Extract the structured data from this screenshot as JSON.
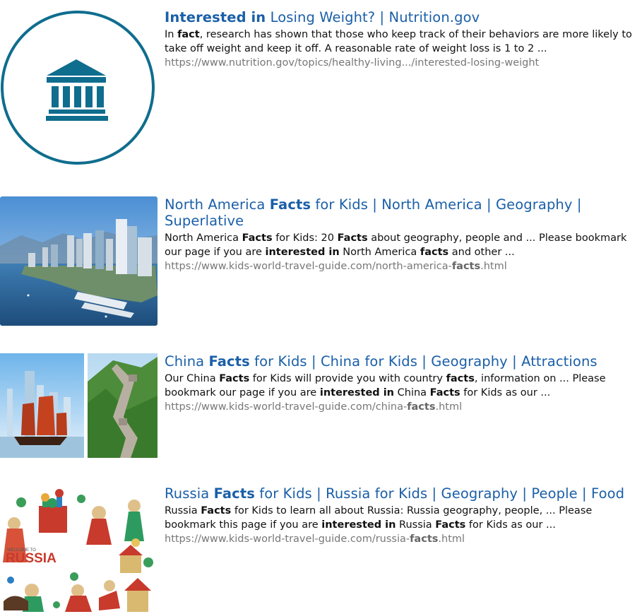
{
  "results": [
    {
      "title": [
        {
          "t": "Interested in",
          "b": true
        },
        {
          "t": " Losing Weight? | Nutrition.gov",
          "b": false
        }
      ],
      "snippet": [
        {
          "t": "In ",
          "b": false
        },
        {
          "t": "fact",
          "b": true
        },
        {
          "t": ", research has shown that those who keep track of their behaviors are more likely to take off weight and keep it off. A reasonable rate of weight loss is 1 to 2 ...",
          "b": false
        }
      ],
      "url": [
        {
          "t": "https://www.nutrition.gov/topics/healthy-living.../interested-losing-weight",
          "b": false
        }
      ],
      "thumbnail_icon": "government-building-icon",
      "accent_color": "#0f6d8e"
    },
    {
      "title": [
        {
          "t": "North America ",
          "b": false
        },
        {
          "t": "Facts",
          "b": true
        },
        {
          "t": " for Kids | North America | Geography | Superlative",
          "b": false
        }
      ],
      "snippet": [
        {
          "t": "North America ",
          "b": false
        },
        {
          "t": "Facts",
          "b": true
        },
        {
          "t": " for Kids: 20 ",
          "b": false
        },
        {
          "t": "Facts",
          "b": true
        },
        {
          "t": " about geography, people and ... Please bookmark our page if you are ",
          "b": false
        },
        {
          "t": "interested in",
          "b": true
        },
        {
          "t": " North America ",
          "b": false
        },
        {
          "t": "facts",
          "b": true
        },
        {
          "t": " and other ...",
          "b": false
        }
      ],
      "url": [
        {
          "t": "https://www.kids-world-travel-guide.com/north-america-",
          "b": false
        },
        {
          "t": "facts",
          "b": true
        },
        {
          "t": ".html",
          "b": false
        }
      ],
      "thumbnail_icon": "city-skyline-photo"
    },
    {
      "title": [
        {
          "t": "China ",
          "b": false
        },
        {
          "t": "Facts",
          "b": true
        },
        {
          "t": " for Kids | China for Kids | Geography | Attractions",
          "b": false
        }
      ],
      "snippet": [
        {
          "t": "Our China ",
          "b": false
        },
        {
          "t": "Facts",
          "b": true
        },
        {
          "t": " for Kids will provide you with country ",
          "b": false
        },
        {
          "t": "facts",
          "b": true
        },
        {
          "t": ", information on ... Please bookmark our page if you are ",
          "b": false
        },
        {
          "t": "interested in",
          "b": true
        },
        {
          "t": " China ",
          "b": false
        },
        {
          "t": "Facts",
          "b": true
        },
        {
          "t": " for Kids as our ...",
          "b": false
        }
      ],
      "url": [
        {
          "t": "https://www.kids-world-travel-guide.com/china-",
          "b": false
        },
        {
          "t": "facts",
          "b": true
        },
        {
          "t": ".html",
          "b": false
        }
      ],
      "thumbnail_icon": "junk-boat-and-great-wall-photo"
    },
    {
      "title": [
        {
          "t": "Russia ",
          "b": false
        },
        {
          "t": "Facts",
          "b": true
        },
        {
          "t": " for Kids | Russia for Kids | Geography | People | Food",
          "b": false
        }
      ],
      "snippet": [
        {
          "t": "Russia ",
          "b": false
        },
        {
          "t": "Facts",
          "b": true
        },
        {
          "t": " for Kids to learn all about Russia: Russia geography, people, ... Please bookmark this page if you are ",
          "b": false
        },
        {
          "t": "interested in",
          "b": true
        },
        {
          "t": " Russia ",
          "b": false
        },
        {
          "t": "Facts",
          "b": true
        },
        {
          "t": " for Kids as our ...",
          "b": false
        }
      ],
      "url": [
        {
          "t": "https://www.kids-world-travel-guide.com/russia-",
          "b": false
        },
        {
          "t": "facts",
          "b": true
        },
        {
          "t": ".html",
          "b": false
        }
      ],
      "thumbnail_icon": "russia-illustration",
      "thumbnail_text": {
        "welcome": "WELCOME TO",
        "country": "RUSSIA"
      }
    }
  ]
}
